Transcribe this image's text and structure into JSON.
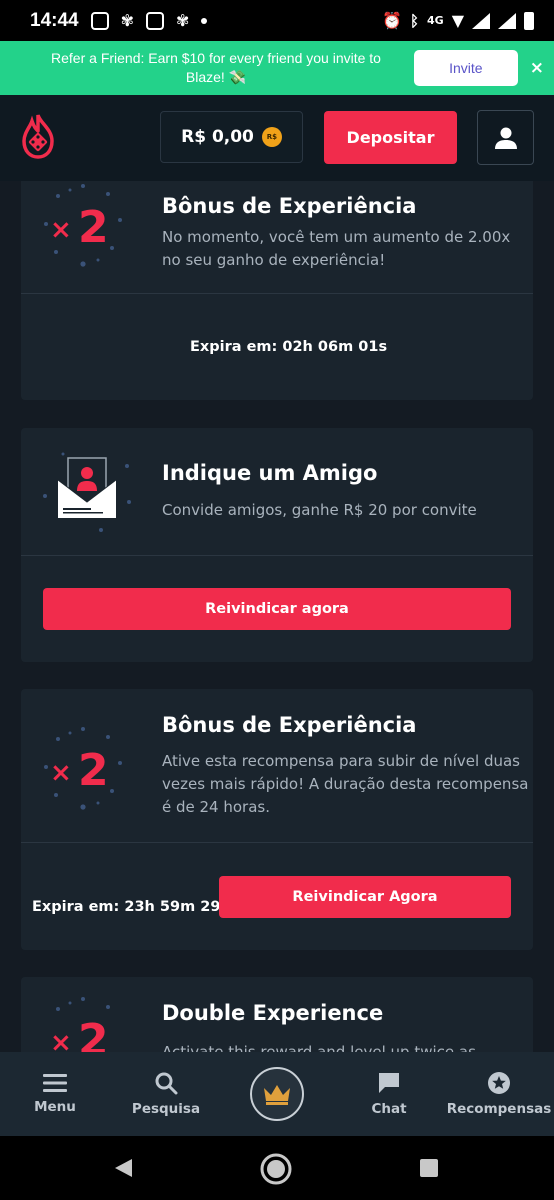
{
  "status_bar": {
    "time": "14:44",
    "network": "4G"
  },
  "banner": {
    "text": "Refer a Friend: Earn $10 for every friend you invite to Blaze! 💸",
    "invite_label": "Invite",
    "close_label": "×"
  },
  "header": {
    "balance": "R$ 0,00",
    "coin_label": "R$",
    "deposit_label": "Depositar"
  },
  "cards": [
    {
      "title": "Bônus de Experiência",
      "description": "No momento, você tem um aumento de 2.00x no seu ganho de experiência!",
      "expires": "Expira em: 02h 06m 01s"
    },
    {
      "title": "Indique um Amigo",
      "description": "Convide amigos, ganhe R$ 20 por convite",
      "button": "Reivindicar agora"
    },
    {
      "title": "Bônus de Experiência",
      "description": "Ative esta recompensa para subir de nível duas vezes mais rápido! A duração desta recompensa é de 24 horas.",
      "expires": "Expira em: 23h 59m 29s",
      "button": "Reivindicar Agora"
    },
    {
      "title": "Double Experience",
      "description": "Activate this reward and level up twice as quickly"
    }
  ],
  "bottom_nav": {
    "items": [
      {
        "label": "Menu",
        "icon": "menu-icon"
      },
      {
        "label": "Pesquisa",
        "icon": "search-icon"
      },
      {
        "label": "",
        "icon": "crown-icon"
      },
      {
        "label": "Chat",
        "icon": "chat-icon"
      },
      {
        "label": "Recompensas",
        "icon": "star-icon"
      }
    ]
  },
  "colors": {
    "accent": "#f12c4c",
    "banner": "#23d28a",
    "card": "#1a242d",
    "background": "#141b23"
  }
}
